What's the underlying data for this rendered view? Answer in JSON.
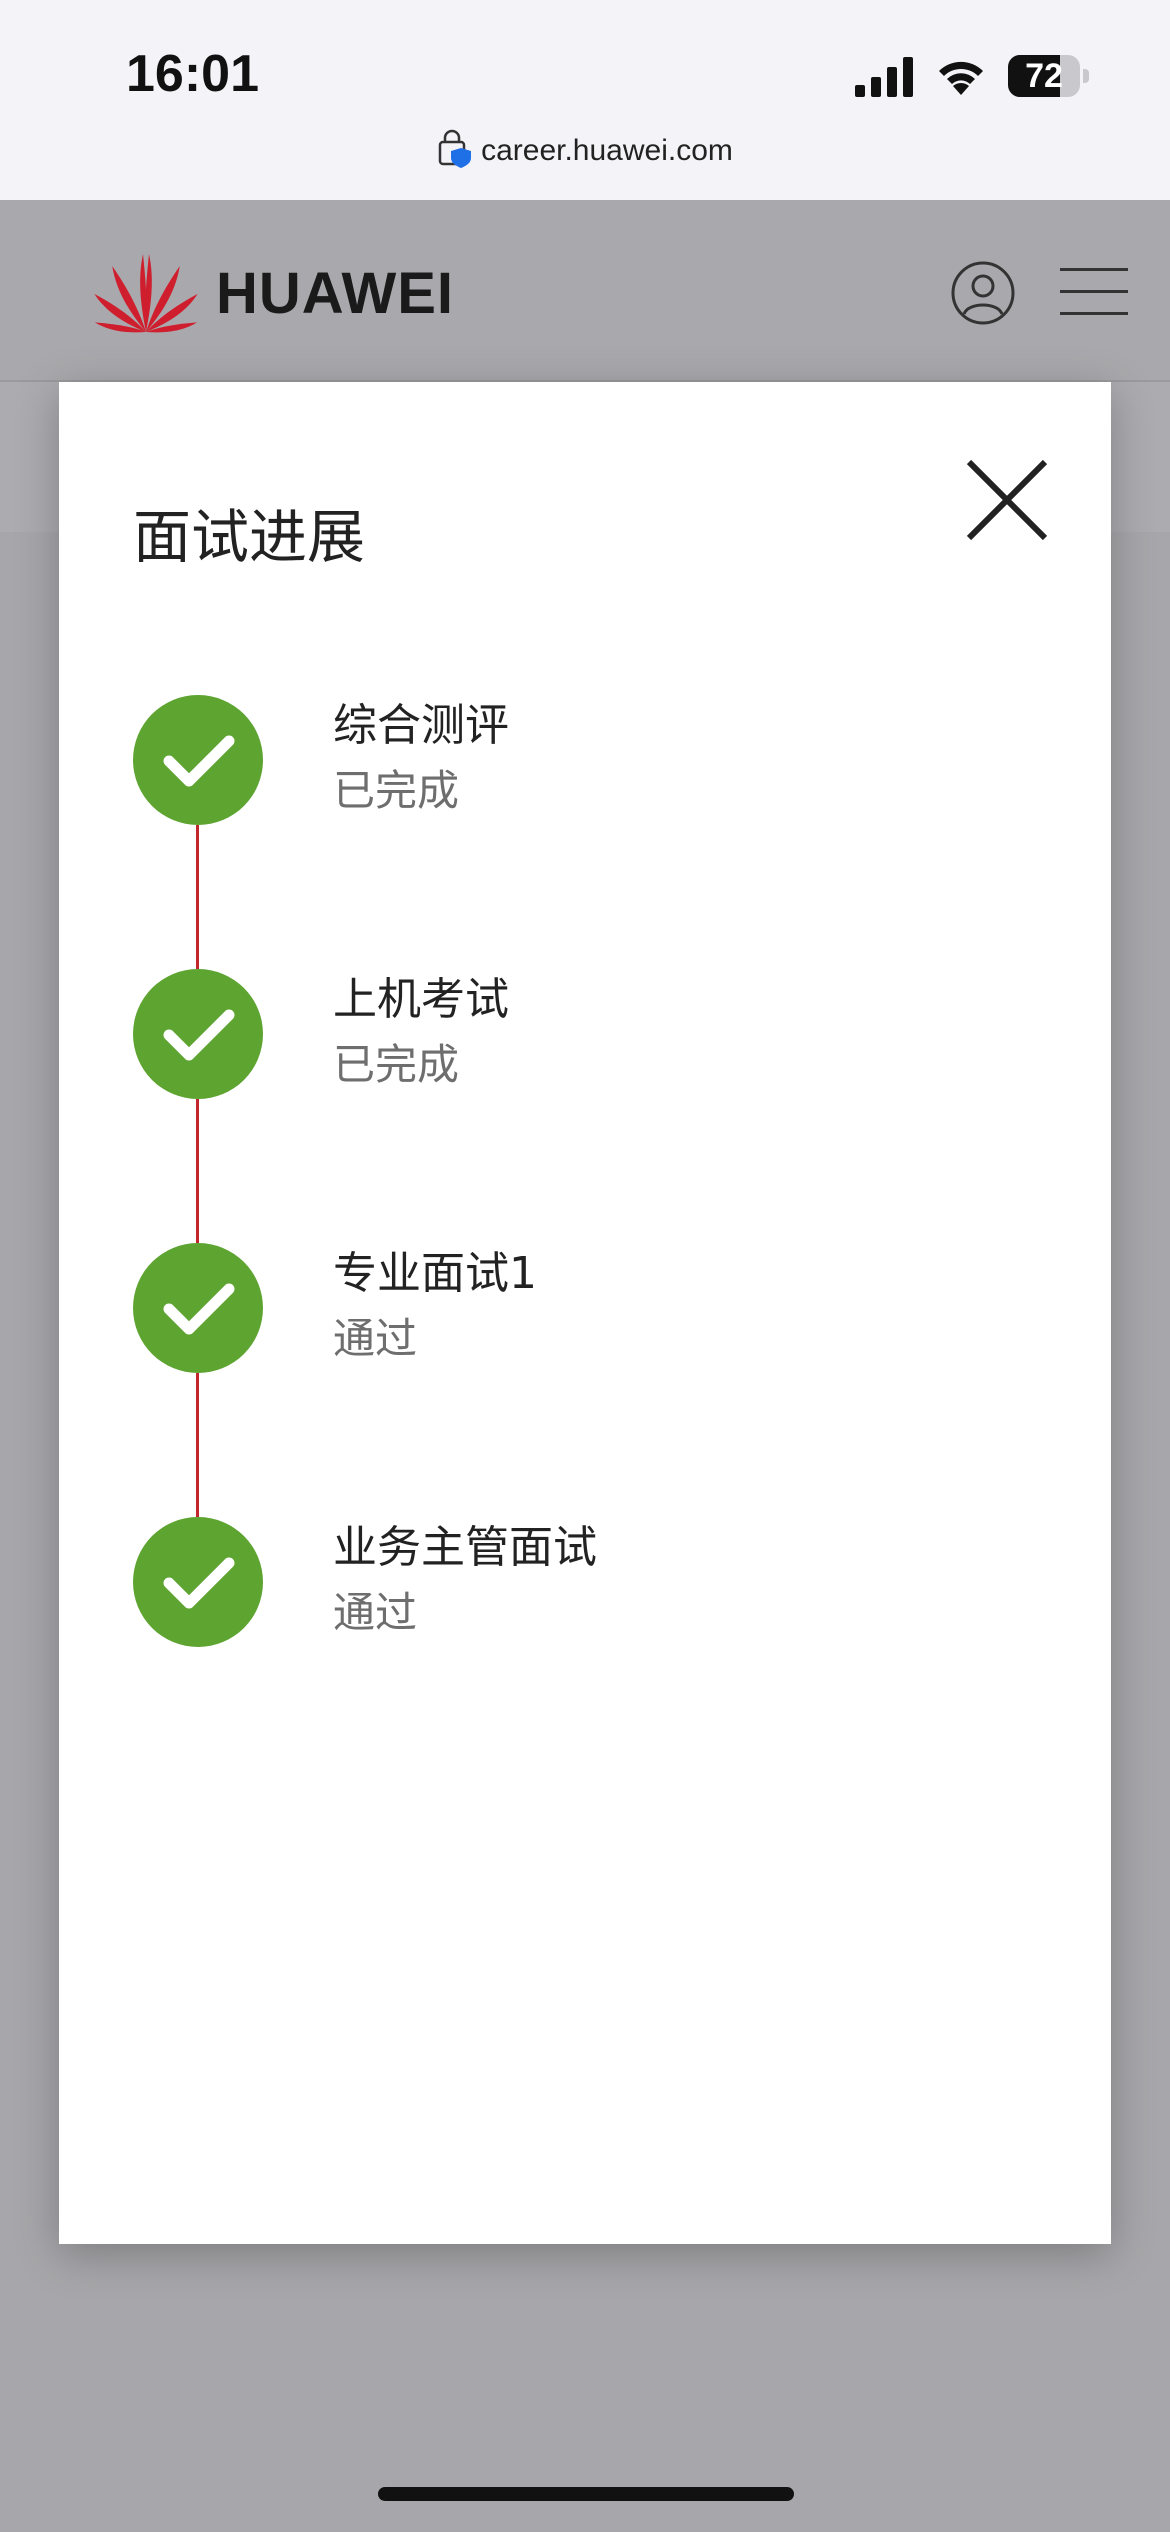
{
  "status_bar": {
    "time": "16:01",
    "battery": "72",
    "battery_level": 0.72,
    "url": "career.huawei.com"
  },
  "header": {
    "brand": "HUAWEI",
    "brand_color": "#cf1f2e"
  },
  "modal": {
    "title": "面试进展",
    "steps": [
      {
        "name": "综合测评",
        "status": "已完成"
      },
      {
        "name": "上机考试",
        "status": "已完成"
      },
      {
        "name": "专业面试1",
        "status": "通过"
      },
      {
        "name": "业务主管面试",
        "status": "通过"
      }
    ]
  },
  "colors": {
    "step_done": "#5da431",
    "connector": "#c0262c"
  }
}
